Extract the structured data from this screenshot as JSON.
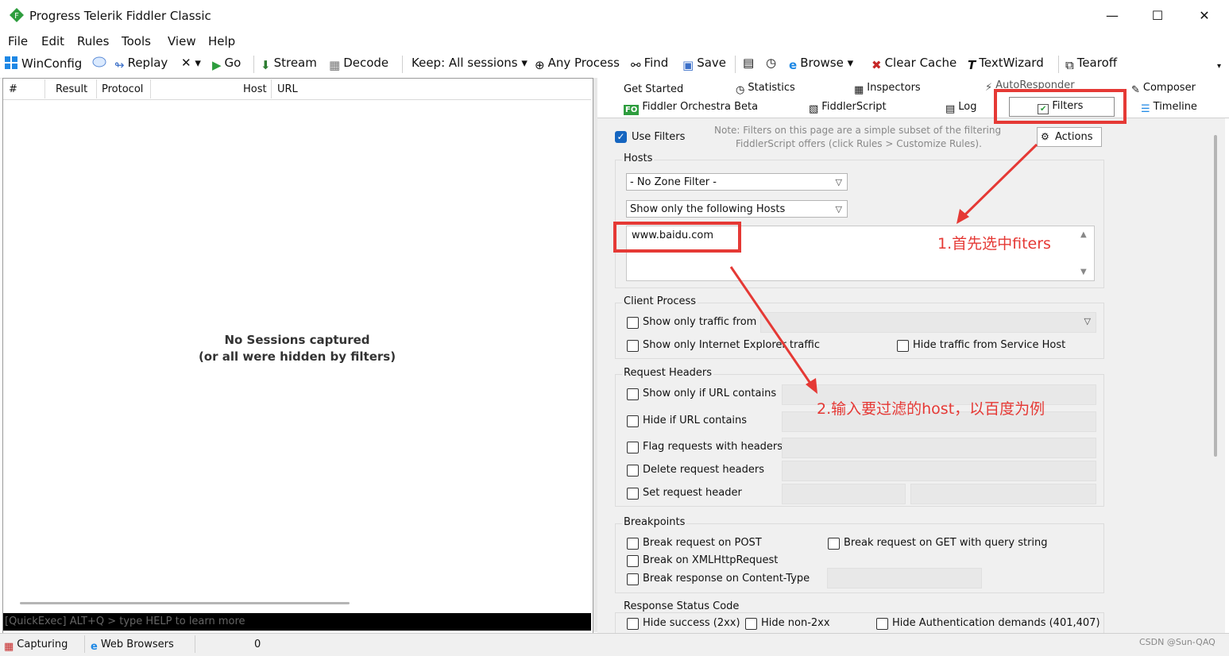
{
  "window": {
    "title": "Progress Telerik Fiddler Classic",
    "minimize": "—",
    "maximize": "☐",
    "close": "✕"
  },
  "menu": [
    "File",
    "Edit",
    "Rules",
    "Tools",
    "View",
    "Help"
  ],
  "toolbar": {
    "winconfig": "WinConfig",
    "replay": "Replay",
    "remove": "✕ ▾",
    "go": "Go",
    "stream": "Stream",
    "decode": "Decode",
    "keep": "Keep: All sessions ▾",
    "any_process": "Any Process",
    "find": "Find",
    "save": "Save",
    "browse": "Browse ▾",
    "clear_cache": "Clear Cache",
    "textwizard": "TextWizard",
    "tearoff": "Tearoff"
  },
  "sessions": {
    "columns": [
      "#",
      "Result",
      "Protocol",
      "Host",
      "URL"
    ],
    "empty_line1": "No Sessions captured",
    "empty_line2": "(or all were hidden by filters)",
    "quickexec": "[QuickExec] ALT+Q > type HELP to learn more"
  },
  "tabs": {
    "row1": [
      "Get Started",
      "Statistics",
      "Inspectors",
      "AutoResponder",
      "Composer"
    ],
    "row2": [
      "Fiddler Orchestra Beta",
      "FiddlerScript",
      "Log",
      "Filters",
      "Timeline"
    ],
    "fo_badge": "FO"
  },
  "filters": {
    "use_filters": "Use Filters",
    "note_line1": "Note: Filters on this page are a simple subset of the filtering",
    "note_line2": "FiddlerScript offers (click Rules > Customize Rules).",
    "actions": "Actions",
    "hosts": {
      "title": "Hosts",
      "zone_filter": "- No Zone Filter -",
      "host_mode": "Show only the following Hosts",
      "host_list": "www.baidu.com"
    },
    "client_process": {
      "title": "Client Process",
      "show_only_traffic_from": "Show only traffic from",
      "show_only_ie": "Show only Internet Explorer traffic",
      "hide_service_host": "Hide traffic from Service Host"
    },
    "request_headers": {
      "title": "Request Headers",
      "show_only_url": "Show only if URL contains",
      "hide_url": "Hide if URL contains",
      "flag_headers": "Flag requests with headers",
      "delete_headers": "Delete request headers",
      "set_header": "Set request header"
    },
    "breakpoints": {
      "title": "Breakpoints",
      "post": "Break request on POST",
      "get_query": "Break request on GET with query string",
      "xhr": "Break on XMLHttpRequest",
      "content_type": "Break response on Content-Type"
    },
    "response_status": {
      "title": "Response Status Code",
      "hide_success": "Hide success (2xx)",
      "hide_non2xx": "Hide non-2xx",
      "hide_auth": "Hide Authentication demands (401,407)"
    }
  },
  "annotations": {
    "step1": "1.首先选中fiters",
    "step2": "2.输入要过滤的host，以百度为例"
  },
  "status": {
    "capturing": "Capturing",
    "web_browsers": "Web Browsers",
    "count": "0"
  },
  "watermark": "CSDN @Sun-QAQ",
  "colors": {
    "accent_red": "#e53935",
    "check_blue": "#1565c0"
  }
}
